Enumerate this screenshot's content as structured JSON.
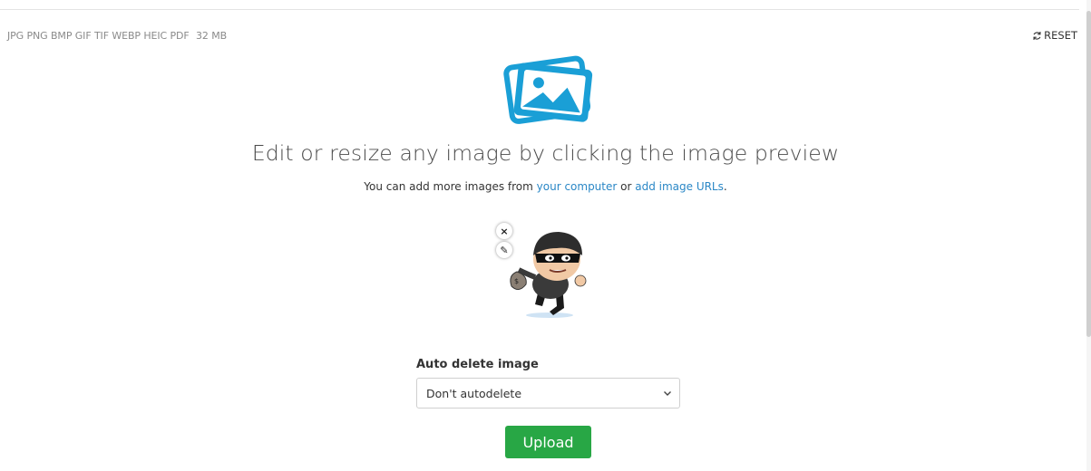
{
  "header": {
    "formats": "JPG PNG BMP GIF TIF WEBP HEIC PDF",
    "max_size": "32 MB",
    "reset_label": "RESET"
  },
  "main": {
    "heading": "Edit or resize any image by clicking the image preview",
    "sub_prefix": "You can add more images from ",
    "link_computer": "your computer",
    "sub_or": " or ",
    "link_urls": "add image URLs",
    "sub_suffix": "."
  },
  "preview": {
    "close_symbol": "×",
    "edit_symbol": "✎"
  },
  "auto_delete": {
    "label": "Auto delete image",
    "selected": "Don't autodelete"
  },
  "actions": {
    "upload_label": "Upload"
  },
  "colors": {
    "accent": "#2a87c6",
    "icon_blue": "#1a9fd6",
    "upload_green": "#28a745"
  }
}
